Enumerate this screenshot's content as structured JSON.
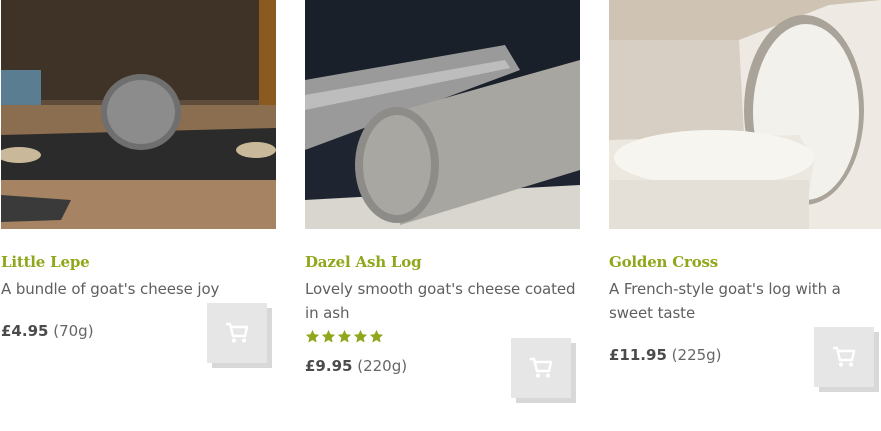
{
  "products": [
    {
      "name": "Little Lepe",
      "description": "A bundle of goat's cheese joy",
      "price": "£4.95",
      "weight": "(70g)",
      "rating": null,
      "image": "round-ash-goats-cheese-photo",
      "cart_icon": "cart-icon"
    },
    {
      "name": "Dazel Ash Log",
      "description": "Lovely smooth goat's cheese coated in ash",
      "price": "£9.95",
      "weight": "(220g)",
      "rating": 5,
      "image": "ash-log-cheese-photo",
      "cart_icon": "cart-icon"
    },
    {
      "name": "Golden Cross",
      "description": "A French-style goat's log with a sweet taste",
      "price": "£11.95",
      "weight": "(225g)",
      "rating": null,
      "image": "white-goats-log-photo",
      "cart_icon": "cart-icon"
    }
  ],
  "colors": {
    "name": "#8fa81b",
    "star": "#8fa81b",
    "cart_button": "#e6e6e6",
    "cart_icon": "#ffffff"
  }
}
